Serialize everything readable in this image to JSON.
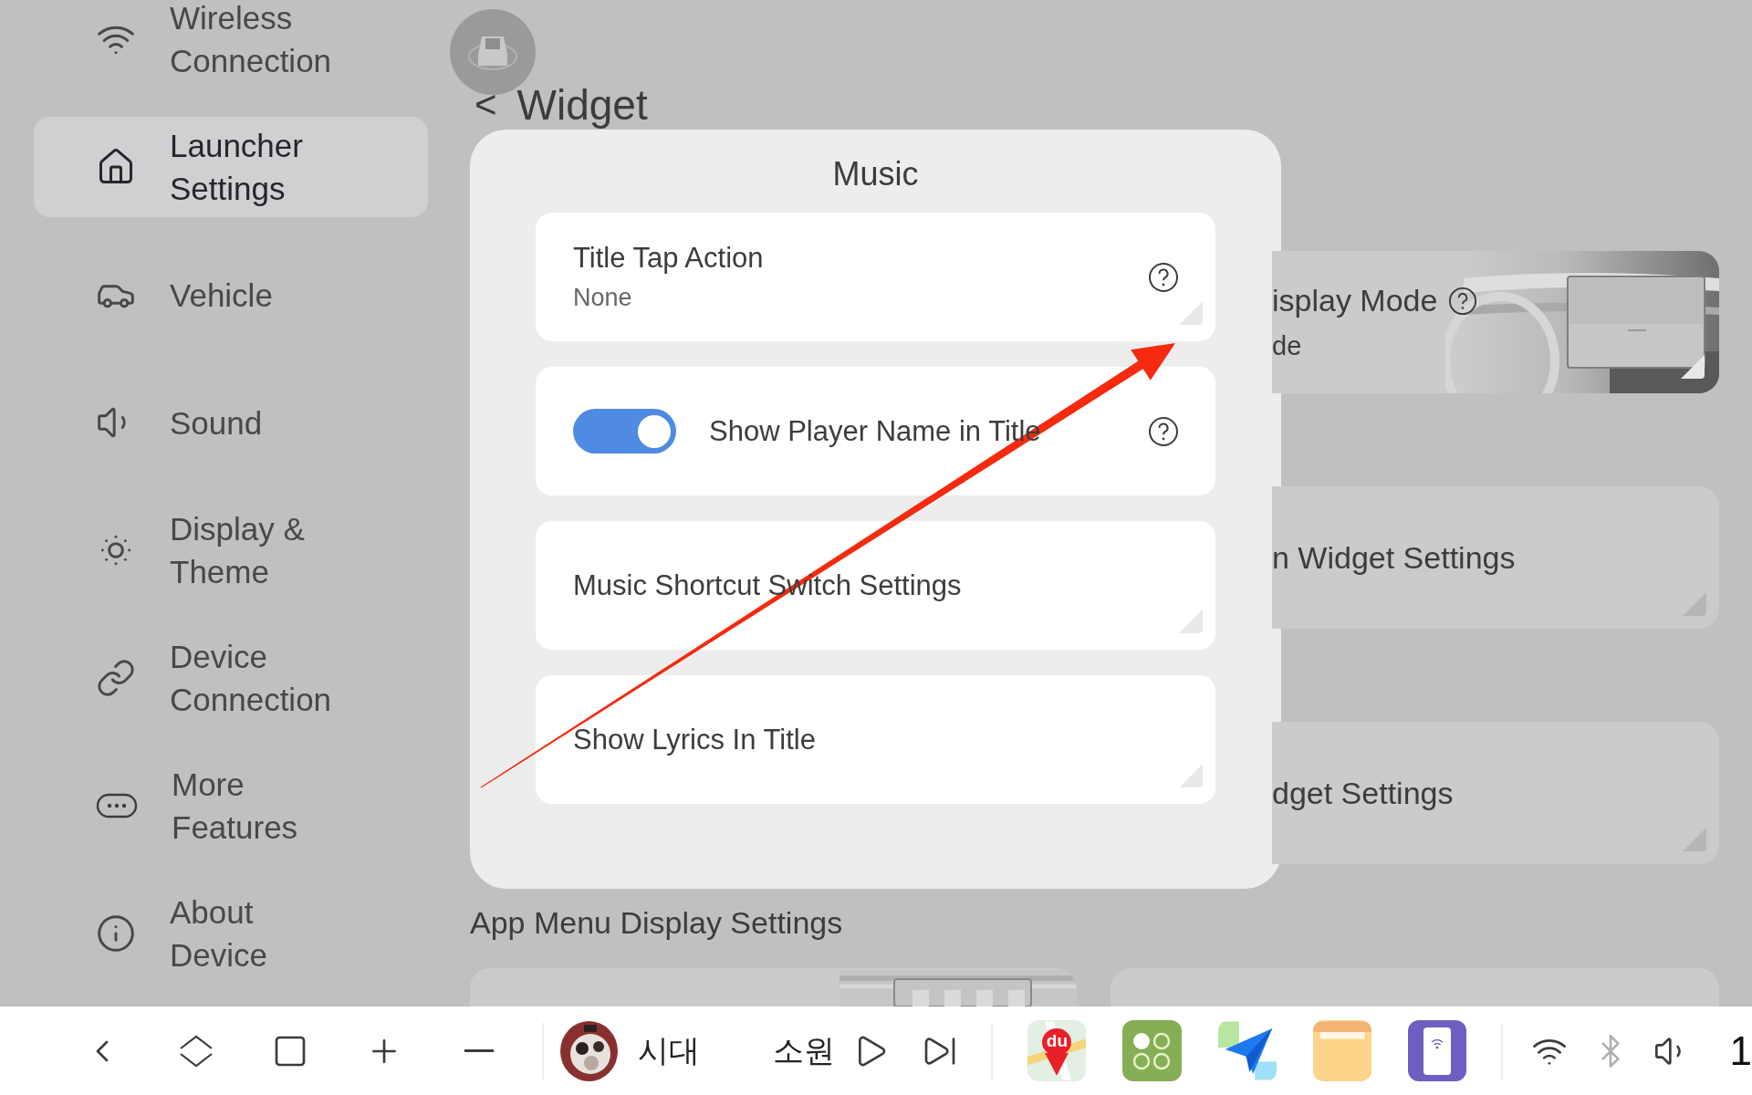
{
  "sidebar": {
    "items": [
      {
        "label": "Wireless Connection",
        "selected": false
      },
      {
        "label": "Launcher Settings",
        "selected": true
      },
      {
        "label": "Vehicle",
        "selected": false
      },
      {
        "label": "Sound",
        "selected": false
      },
      {
        "label": "Display & Theme",
        "selected": false
      },
      {
        "label": "Device Connection",
        "selected": false
      },
      {
        "label": "More Features",
        "selected": false
      },
      {
        "label": "About Device",
        "selected": false
      }
    ]
  },
  "header": {
    "back": "<",
    "title": "Widget"
  },
  "dialog": {
    "title": "Music",
    "items": [
      {
        "kind": "select",
        "title": "Title Tap Action",
        "value": "None",
        "help": true
      },
      {
        "kind": "toggle",
        "label": "Show Player Name in Title",
        "on": true,
        "help": true
      },
      {
        "kind": "link",
        "label": "Music Shortcut Switch Settings",
        "help": false
      },
      {
        "kind": "link",
        "label": "Show Lyrics In Title",
        "help": false
      }
    ]
  },
  "background_cards": [
    {
      "title": "isplay Mode",
      "value": "de",
      "help": true,
      "preview": {
        "kind": "picture"
      }
    },
    {
      "title": "n Widget Settings",
      "help": false
    },
    {
      "title": "dget Settings",
      "help": false
    }
  ],
  "section_title": "App Menu Display Settings",
  "bottom_cards": [
    {
      "kind": "picture"
    },
    {
      "kind": "plain"
    }
  ],
  "taskbar": {
    "media": {
      "line_1": "시대",
      "line_2": "소원"
    },
    "apps": [
      {
        "kind": "map",
        "label": "du"
      },
      {
        "kind": "grid"
      },
      {
        "kind": "send"
      },
      {
        "kind": "folder"
      },
      {
        "kind": "phone"
      }
    ],
    "clock": "1"
  },
  "annotation": {
    "kind": "arrow"
  }
}
